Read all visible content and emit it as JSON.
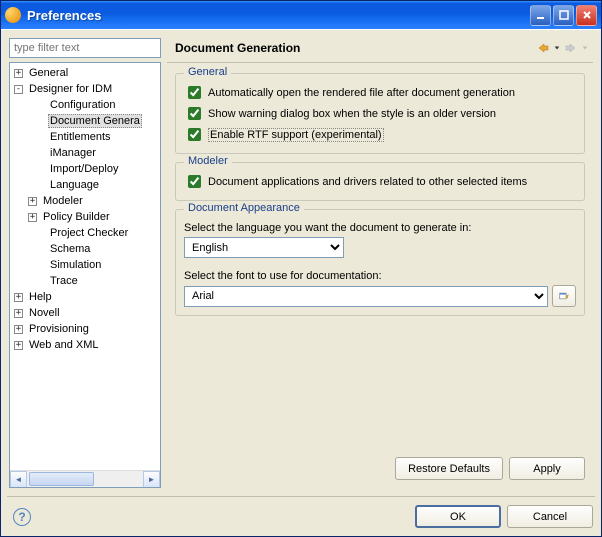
{
  "window": {
    "title": "Preferences"
  },
  "filter": {
    "placeholder": "type filter text"
  },
  "tree": [
    {
      "label": "General",
      "level": 0,
      "expander": "+"
    },
    {
      "label": "Designer for IDM",
      "level": 0,
      "expander": "-"
    },
    {
      "label": "Configuration",
      "level": 2
    },
    {
      "label": "Document Genera",
      "level": 2,
      "selected": true
    },
    {
      "label": "Entitlements",
      "level": 2
    },
    {
      "label": "iManager",
      "level": 2
    },
    {
      "label": "Import/Deploy",
      "level": 2
    },
    {
      "label": "Language",
      "level": 2
    },
    {
      "label": "Modeler",
      "level": 1,
      "expander": "+"
    },
    {
      "label": "Policy Builder",
      "level": 1,
      "expander": "+"
    },
    {
      "label": "Project Checker",
      "level": 2
    },
    {
      "label": "Schema",
      "level": 2
    },
    {
      "label": "Simulation",
      "level": 2
    },
    {
      "label": "Trace",
      "level": 2
    },
    {
      "label": "Help",
      "level": 0,
      "expander": "+"
    },
    {
      "label": "Novell",
      "level": 0,
      "expander": "+"
    },
    {
      "label": "Provisioning",
      "level": 0,
      "expander": "+"
    },
    {
      "label": "Web and XML",
      "level": 0,
      "expander": "+"
    }
  ],
  "page": {
    "title": "Document Generation",
    "groups": {
      "general": {
        "label": "General",
        "opt1": "Automatically open the rendered file after document generation",
        "opt2": "Show warning dialog box when the style is an older version",
        "opt3": "Enable RTF support (experimental)"
      },
      "modeler": {
        "label": "Modeler",
        "opt1": "Document applications and drivers related to other selected items"
      },
      "appearance": {
        "label": "Document Appearance",
        "lang_desc": "Select the language you want the document to generate in:",
        "lang_value": "English",
        "font_desc": "Select the font to use for documentation:",
        "font_value": "Arial"
      }
    },
    "restore": "Restore Defaults",
    "apply": "Apply"
  },
  "footer": {
    "ok": "OK",
    "cancel": "Cancel"
  }
}
